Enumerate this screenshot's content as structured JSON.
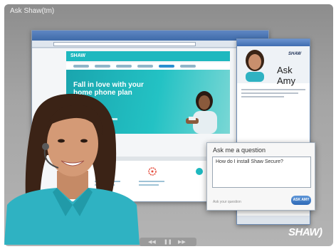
{
  "frame": {
    "title": "Ask Shaw(tm)"
  },
  "website": {
    "logo": "SHAW",
    "hero_headline": "Fall in love with your home phone plan"
  },
  "ask_amy": {
    "title": "Ask Amy",
    "brand": "SHAW"
  },
  "ask_box": {
    "heading": "Ask me a question",
    "question": "How do I install Shaw Secure?",
    "hint": "Ask your question",
    "button_label": "ASK AMY"
  },
  "brand": {
    "logo_text": "SHAW)",
    "accent_color": "#1eb8bf",
    "button_color": "#2f6ab7"
  },
  "player": {
    "prev_icon": "previous-icon",
    "pause_icon": "pause-icon",
    "next_icon": "next-icon"
  }
}
